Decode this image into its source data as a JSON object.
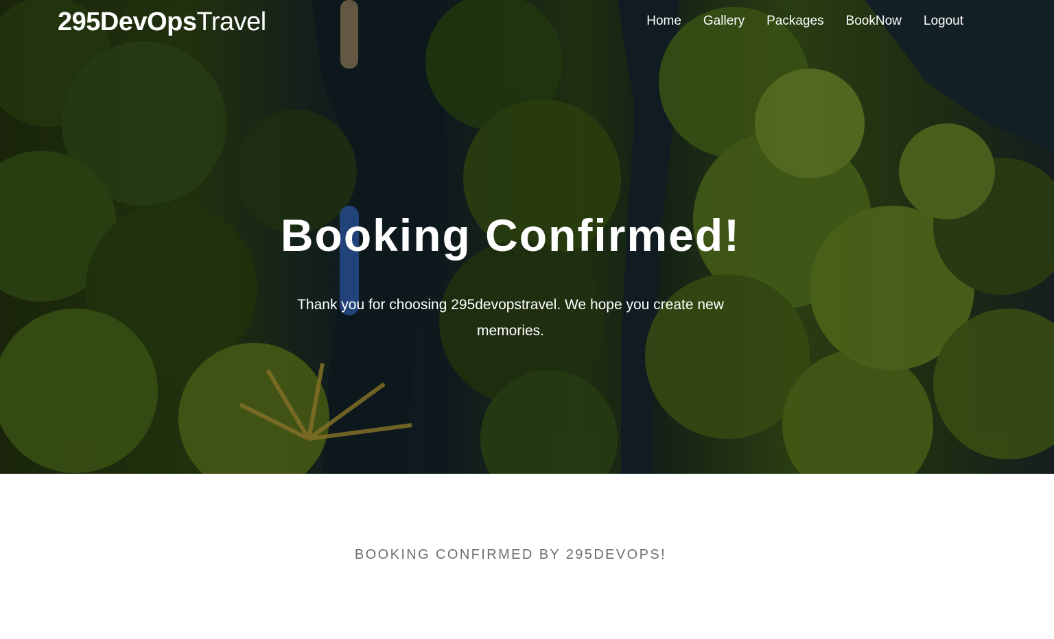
{
  "navbar": {
    "brand_bold": "295DevOps",
    "brand_light": "Travel",
    "links": [
      {
        "label": "Home"
      },
      {
        "label": "Gallery"
      },
      {
        "label": "Packages"
      },
      {
        "label": "BookNow"
      },
      {
        "label": "Logout"
      }
    ]
  },
  "hero": {
    "title": "Booking Confirmed!",
    "subtitle": "Thank you for choosing 295devopstravel. We hope you create new memories."
  },
  "content": {
    "confirmation_note": "BOOKING CONFIRMED BY 295DEVOPS!"
  },
  "colors": {
    "nav_text": "#ffffff",
    "note_text": "#6f6f6f",
    "background": "#ffffff"
  }
}
